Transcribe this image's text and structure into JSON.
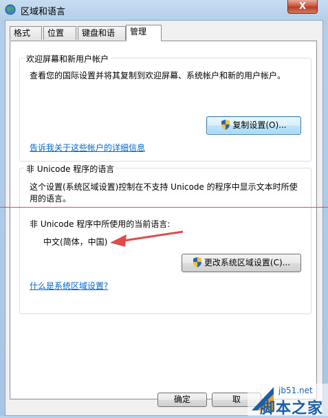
{
  "window": {
    "title": "区域和语言",
    "close_label": "X"
  },
  "tabs": [
    {
      "label": "格式"
    },
    {
      "label": "位置"
    },
    {
      "label": "键盘和语言"
    },
    {
      "label": "管理",
      "active": true
    }
  ],
  "welcome_group": {
    "title": "欢迎屏幕和新用户帐户",
    "description": "查看您的国际设置并将其复制到欢迎屏幕、系统帐户和新的用户帐户。",
    "copy_button": "复制设置(O)...",
    "details_link": "告诉我关于这些帐户的详细信息"
  },
  "unicode_group": {
    "title": "非 Unicode 程序的语言",
    "description_line1": "这个设置(系统区域设置)控制在不支持 Unicode 的程序中显示文本时所使",
    "description_line2": "用的语言。",
    "current_label": "非 Unicode 程序中所使用的当前语言:",
    "current_value": "中文(简体，中国)",
    "change_button": "更改系统区域设置(C)...",
    "help_link": "什么是系统区域设置?"
  },
  "footer": {
    "ok_button": "确定",
    "cancel_button": "取"
  },
  "watermark": {
    "top": "jb51.net",
    "main": "脚本之家"
  },
  "colors": {
    "link": "#0066cc",
    "annotation_red": "#e04a4a"
  }
}
